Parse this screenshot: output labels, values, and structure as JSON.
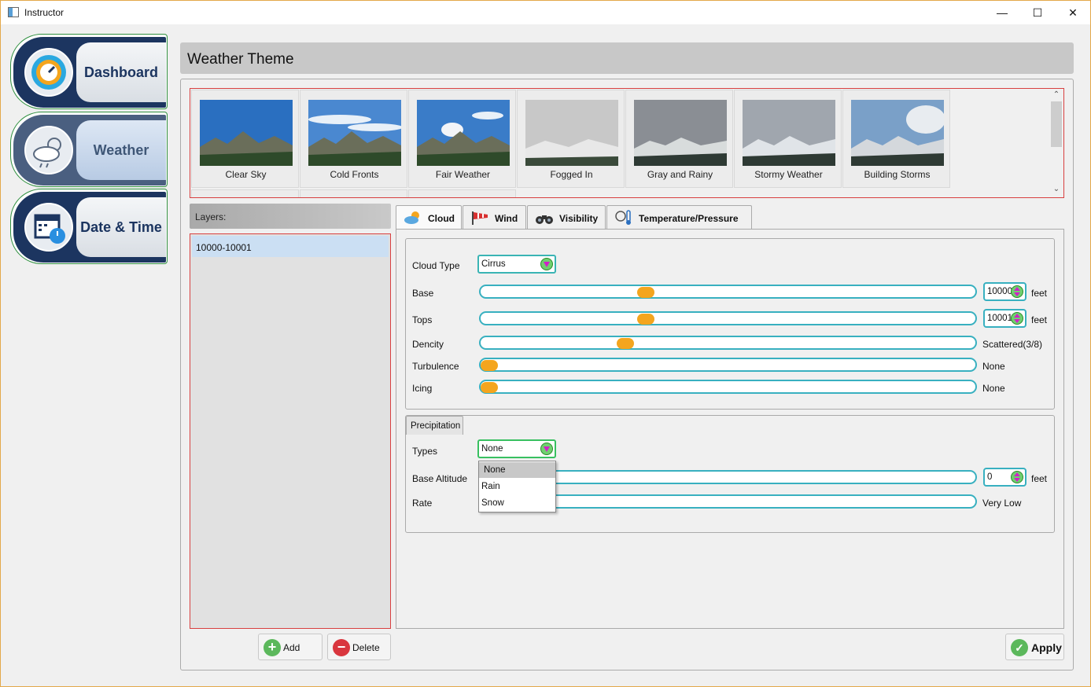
{
  "window": {
    "title": "Instructor",
    "minimize": "—",
    "maximize": "☐",
    "close": "✕"
  },
  "nav": [
    {
      "label": "Dashboard",
      "icon": "dashboard-gauge-icon",
      "active": false
    },
    {
      "label": "Weather",
      "icon": "weather-cloud-sun-icon",
      "active": true
    },
    {
      "label": "Date & Time",
      "icon": "calendar-clock-icon",
      "active": false
    }
  ],
  "header": {
    "title": "Weather Theme"
  },
  "themes": [
    {
      "name": "Clear Sky",
      "sky": "#2a6fc0"
    },
    {
      "name": "Cold Fronts",
      "sky": "#4a88d0"
    },
    {
      "name": "Fair Weather",
      "sky": "#3a7cc8"
    },
    {
      "name": "Fogged In",
      "sky": "#c8c8c8"
    },
    {
      "name": "Gray and Rainy",
      "sky": "#8a8e94"
    },
    {
      "name": "Stormy Weather",
      "sky": "#a0a6ae"
    },
    {
      "name": "Building Storms",
      "sky": "#7aa0c8"
    }
  ],
  "layers": {
    "heading": "Layers:",
    "items": [
      "10000-10001"
    ],
    "add_label": "Add",
    "delete_label": "Delete"
  },
  "tabs": [
    {
      "label": "Cloud",
      "icon": "cloud-sun-icon",
      "active": true
    },
    {
      "label": "Wind",
      "icon": "windsock-icon",
      "active": false
    },
    {
      "label": "Visibility",
      "icon": "binoculars-icon",
      "active": false
    },
    {
      "label": "Temperature/Pressure",
      "icon": "thermometer-gauge-icon",
      "active": false
    }
  ],
  "cloud": {
    "type_label": "Cloud Type",
    "type_value": "Cirrus",
    "base": {
      "label": "Base",
      "value": "10000",
      "unit": "feet",
      "position": 0.33
    },
    "tops": {
      "label": "Tops",
      "value": "10001",
      "unit": "feet",
      "position": 0.33
    },
    "density": {
      "label": "Dencity",
      "readout": "Scattered(3/8)",
      "position": 0.29
    },
    "turbulence": {
      "label": "Turbulence",
      "readout": "None",
      "position": 0.0
    },
    "icing": {
      "label": "Icing",
      "readout": "None",
      "position": 0.0
    }
  },
  "precipitation": {
    "group_label": "Precipitation",
    "types_label": "Types",
    "types_value": "None",
    "options": [
      "None",
      "Rain",
      "Snow"
    ],
    "base_altitude": {
      "label": "Base Altitude",
      "value": "0",
      "unit": "feet"
    },
    "rate": {
      "label": "Rate",
      "readout": "Very Low"
    }
  },
  "apply_label": "Apply",
  "colors": {
    "accent_teal": "#38b0c0",
    "knob_orange": "#f4a51e",
    "nav_navy": "#1c3560",
    "error_red": "#d84040"
  }
}
